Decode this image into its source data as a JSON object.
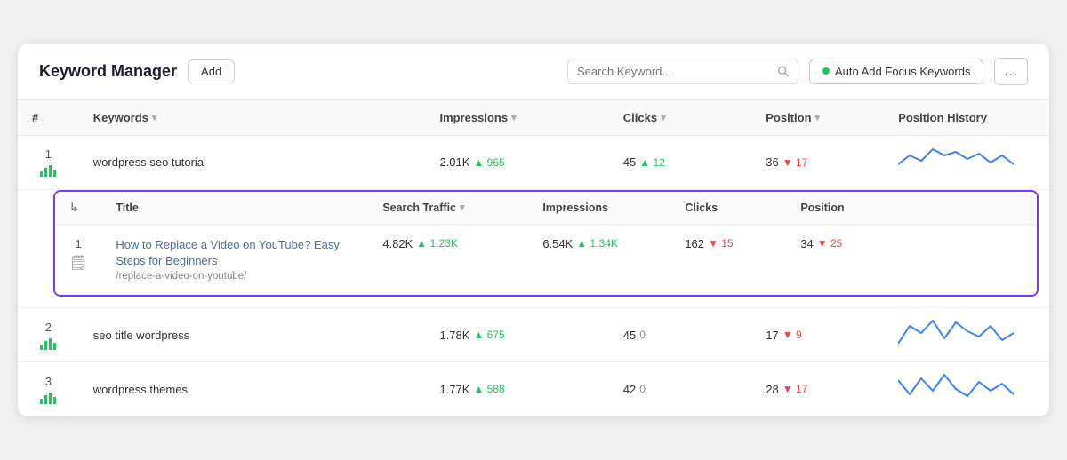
{
  "header": {
    "title": "Keyword Manager",
    "add_label": "Add",
    "search_placeholder": "Search Keyword...",
    "auto_add_label": "Auto Add Focus Keywords",
    "more_label": "..."
  },
  "table": {
    "columns": [
      "#",
      "Keywords",
      "Impressions",
      "Clicks",
      "Position",
      "Position History"
    ],
    "rows": [
      {
        "num": "1",
        "keyword": "wordpress seo tutorial",
        "impressions_base": "2.01K",
        "impressions_delta": "965",
        "impressions_delta_dir": "up",
        "clicks_base": "45",
        "clicks_delta": "12",
        "clicks_delta_dir": "up",
        "position_base": "36",
        "position_delta": "17",
        "position_delta_dir": "down",
        "has_sparkline": true,
        "expanded": true,
        "sub": {
          "columns": [
            "Title",
            "Search Traffic",
            "Impressions",
            "Clicks",
            "Position"
          ],
          "row": {
            "title": "How to Replace a Video on YouTube? Easy Steps for Beginners",
            "url": "/replace-a-video-on-youtube/",
            "search_traffic_base": "4.82K",
            "search_traffic_delta": "1.23K",
            "search_traffic_delta_dir": "up",
            "impressions_base": "6.54K",
            "impressions_delta": "1.34K",
            "impressions_delta_dir": "up",
            "clicks_base": "162",
            "clicks_delta": "15",
            "clicks_delta_dir": "down",
            "position_base": "34",
            "position_delta": "25",
            "position_delta_dir": "down"
          }
        }
      },
      {
        "num": "2",
        "keyword": "seo title wordpress",
        "impressions_base": "1.78K",
        "impressions_delta": "675",
        "impressions_delta_dir": "up",
        "clicks_base": "45",
        "clicks_delta": "0",
        "clicks_delta_dir": "neutral",
        "position_base": "17",
        "position_delta": "9",
        "position_delta_dir": "down",
        "has_sparkline": true,
        "expanded": false
      },
      {
        "num": "3",
        "keyword": "wordpress themes",
        "impressions_base": "1.77K",
        "impressions_delta": "588",
        "impressions_delta_dir": "up",
        "clicks_base": "42",
        "clicks_delta": "0",
        "clicks_delta_dir": "neutral",
        "position_base": "28",
        "position_delta": "17",
        "position_delta_dir": "down",
        "has_sparkline": true,
        "expanded": false
      }
    ]
  },
  "sparklines": {
    "row1": [
      [
        0,
        18
      ],
      [
        10,
        28
      ],
      [
        20,
        22
      ],
      [
        30,
        35
      ],
      [
        40,
        28
      ],
      [
        50,
        32
      ],
      [
        60,
        24
      ],
      [
        70,
        30
      ],
      [
        80,
        20
      ],
      [
        90,
        28
      ],
      [
        100,
        18
      ]
    ],
    "row2": [
      [
        0,
        10
      ],
      [
        10,
        22
      ],
      [
        20,
        18
      ],
      [
        30,
        26
      ],
      [
        40,
        16
      ],
      [
        50,
        28
      ],
      [
        60,
        22
      ],
      [
        70,
        18
      ],
      [
        80,
        24
      ],
      [
        90,
        16
      ],
      [
        100,
        20
      ]
    ],
    "row3": [
      [
        0,
        22
      ],
      [
        10,
        16
      ],
      [
        20,
        24
      ],
      [
        30,
        18
      ],
      [
        40,
        28
      ],
      [
        50,
        20
      ],
      [
        60,
        16
      ],
      [
        70,
        24
      ],
      [
        80,
        18
      ],
      [
        90,
        22
      ],
      [
        100,
        16
      ]
    ]
  }
}
